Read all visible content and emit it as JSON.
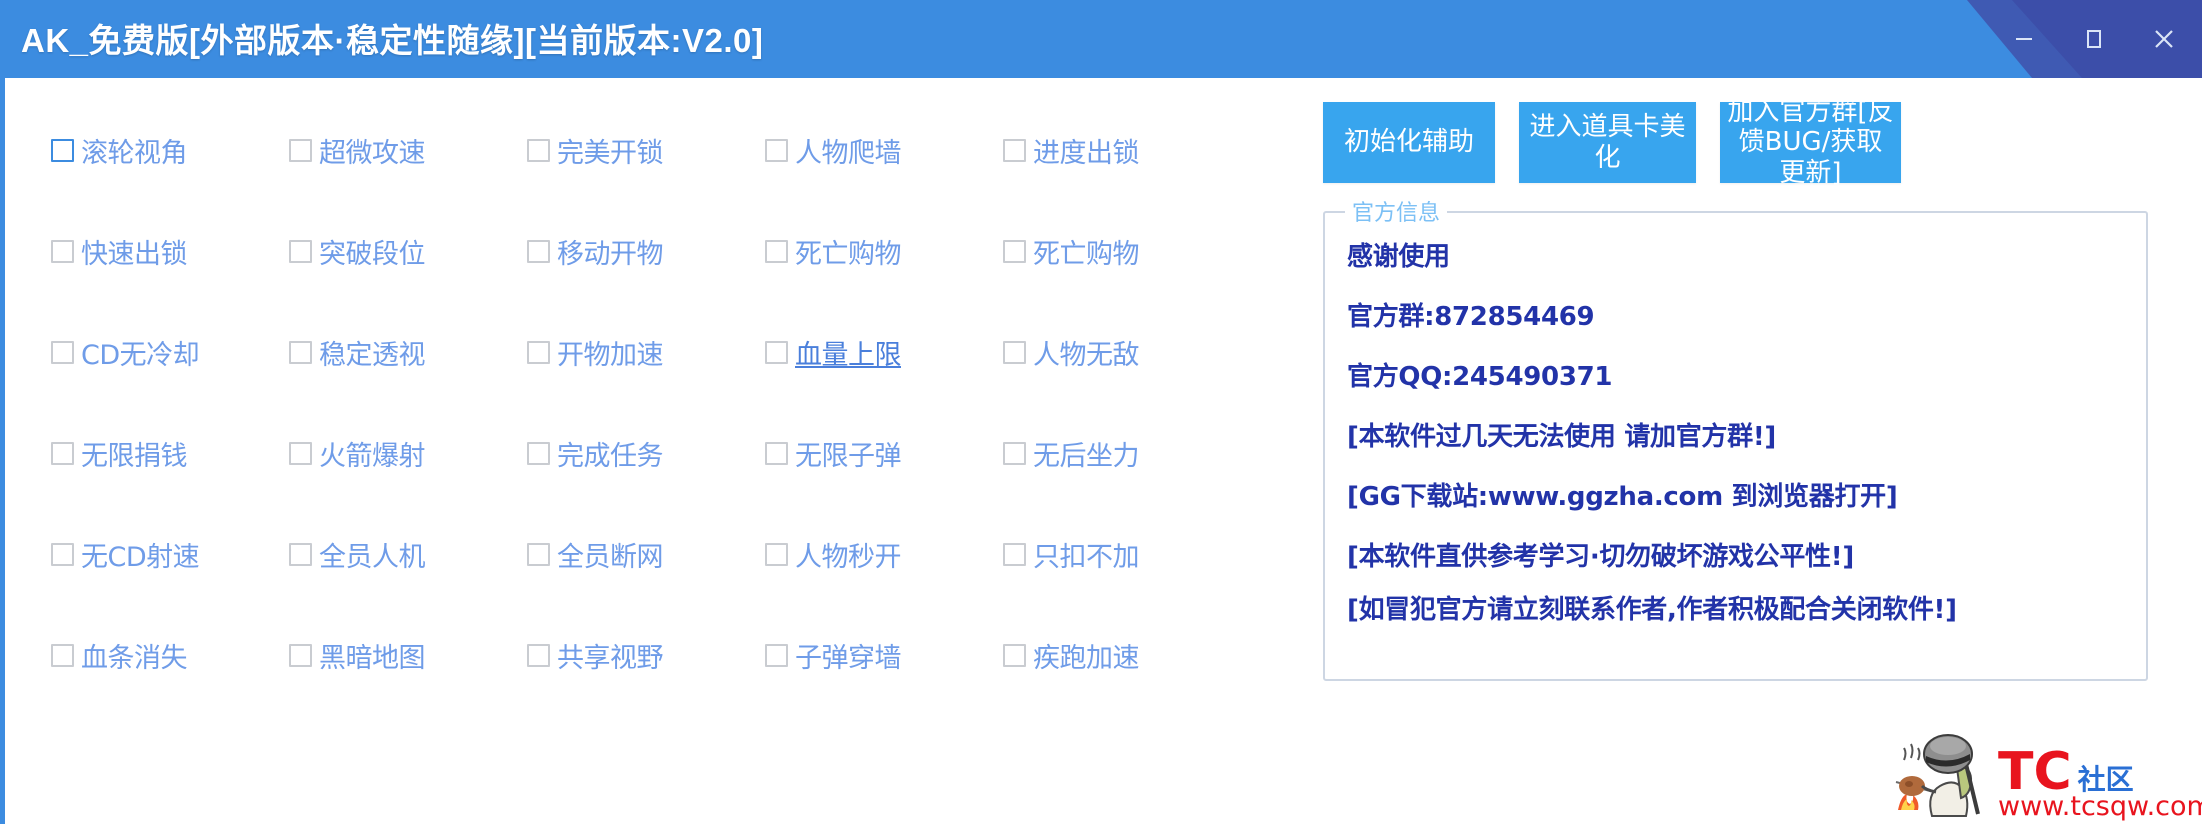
{
  "window": {
    "title": "AK_免费版[外部版本·稳定性随缘][当前版本:V2.0]",
    "controls": {
      "minimize": "minimize-icon",
      "maximize": "maximize-icon",
      "close": "close-icon"
    },
    "accent_color": "#3c8ce0",
    "button_color": "#38a5ee"
  },
  "checkboxes": {
    "rows": [
      [
        {
          "label": "滚轮视角",
          "checked": false,
          "focused": true
        },
        {
          "label": "超微攻速",
          "checked": false,
          "focused": false
        },
        {
          "label": "完美开锁",
          "checked": false,
          "focused": false
        },
        {
          "label": "人物爬墙",
          "checked": false,
          "focused": false
        },
        {
          "label": "进度出锁",
          "checked": false,
          "focused": false
        }
      ],
      [
        {
          "label": "快速出锁",
          "checked": false,
          "focused": false
        },
        {
          "label": "突破段位",
          "checked": false,
          "focused": false
        },
        {
          "label": "移动开物",
          "checked": false,
          "focused": false
        },
        {
          "label": "死亡购物",
          "checked": false,
          "focused": false
        },
        {
          "label": "死亡购物",
          "checked": false,
          "focused": false
        }
      ],
      [
        {
          "label": "CD无冷却",
          "checked": false,
          "focused": false
        },
        {
          "label": "稳定透视",
          "checked": false,
          "focused": false
        },
        {
          "label": "开物加速",
          "checked": false,
          "focused": false
        },
        {
          "label": "血量上限",
          "checked": false,
          "focused": false,
          "accent": true
        },
        {
          "label": "人物无敌",
          "checked": false,
          "focused": false
        }
      ],
      [
        {
          "label": "无限捐钱",
          "checked": false,
          "focused": false
        },
        {
          "label": "火箭爆射",
          "checked": false,
          "focused": false
        },
        {
          "label": "完成任务",
          "checked": false,
          "focused": false
        },
        {
          "label": "无限子弹",
          "checked": false,
          "focused": false
        },
        {
          "label": "无后坐力",
          "checked": false,
          "focused": false
        }
      ],
      [
        {
          "label": "无CD射速",
          "checked": false,
          "focused": false
        },
        {
          "label": "全员人机",
          "checked": false,
          "focused": false
        },
        {
          "label": "全员断网",
          "checked": false,
          "focused": false
        },
        {
          "label": "人物秒开",
          "checked": false,
          "focused": false
        },
        {
          "label": "只扣不加",
          "checked": false,
          "focused": false
        }
      ],
      [
        {
          "label": "血条消失",
          "checked": false,
          "focused": false
        },
        {
          "label": "黑暗地图",
          "checked": false,
          "focused": false
        },
        {
          "label": "共享视野",
          "checked": false,
          "focused": false
        },
        {
          "label": "子弹穿墙",
          "checked": false,
          "focused": false
        },
        {
          "label": "疾跑加速",
          "checked": false,
          "focused": false
        }
      ]
    ]
  },
  "actions": {
    "init": "初始化辅助",
    "item_card": "进入道具卡美化",
    "join_group": "加入官方群[反馈BUG/获取更新]"
  },
  "info_panel": {
    "legend": "官方信息",
    "lines": [
      "感谢使用",
      "官方群:872854469",
      "官方QQ:245490371",
      "[本软件过几天无法使用 请加官方群!]",
      "[GG下载站:www.ggzha.com 到浏览器打开]",
      "[本软件直供参考学习·切勿破坏游戏公平性!]",
      "[如冒犯官方请立刻联系作者,作者积极配合关闭软件!]"
    ]
  },
  "watermark": {
    "brand": "TC",
    "brand_suffix": "社区",
    "url": "www.tcsqw.com"
  }
}
